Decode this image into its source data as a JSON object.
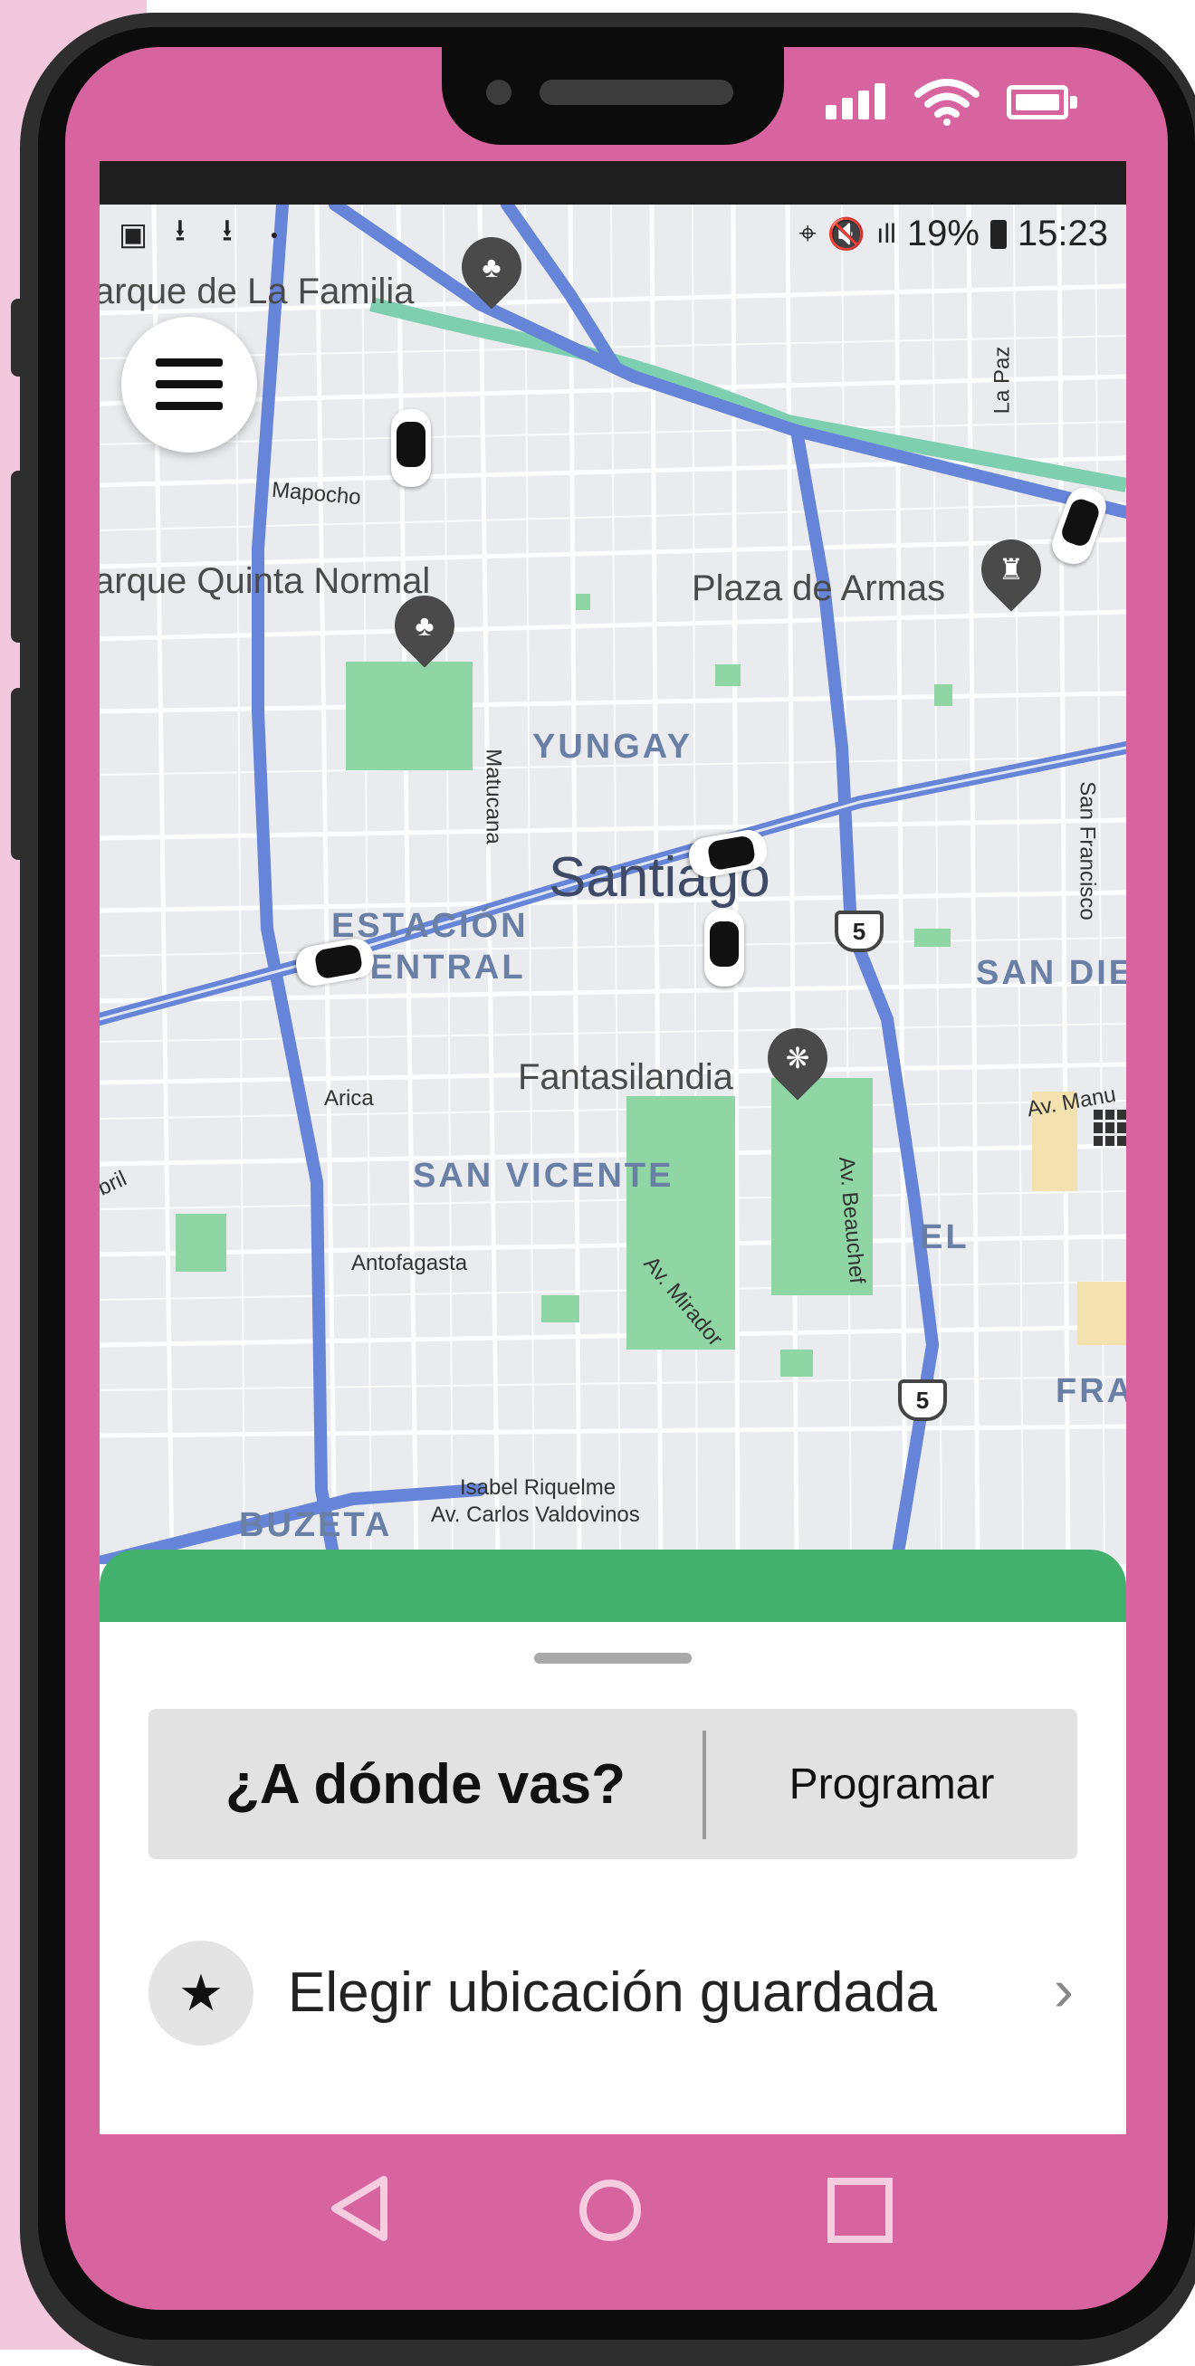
{
  "status": {
    "time": "15:23",
    "battery": "19%"
  },
  "map": {
    "city": "Santiago",
    "places": {
      "parque_familia": "arque de La Familia",
      "quinta_normal": "arque Quinta Normal",
      "plaza_armas": "Plaza de Armas",
      "fantasilandia": "Fantasilandia"
    },
    "districts": {
      "yungay": "YUNGAY",
      "estacion1": "ESTACIÓN",
      "estacion2": "CENTRAL",
      "san_vicente": "SAN VICENTE",
      "san_diego": "SAN DIEG",
      "el": "EL",
      "fra": "FRA",
      "buzeta": "BUZETA"
    },
    "streets": {
      "mapocho": "Mapocho",
      "la_paz": "La Paz",
      "matucana": "Matucana",
      "san_francisco": "San Francisco",
      "arica": "Arica",
      "antofagasta": "Antofagasta",
      "beauchef": "Av. Beauchef",
      "mirador": "Av. Mirador",
      "isabel": "Isabel Riquelme",
      "valdovinos": "Av. Carlos Valdovinos",
      "av_manu": "Av. Manu",
      "bril": "bril"
    },
    "highway": "5"
  },
  "sheet": {
    "search_label": "¿A dónde vas?",
    "schedule_label": "Programar",
    "saved_label": "Elegir ubicación guardada"
  }
}
